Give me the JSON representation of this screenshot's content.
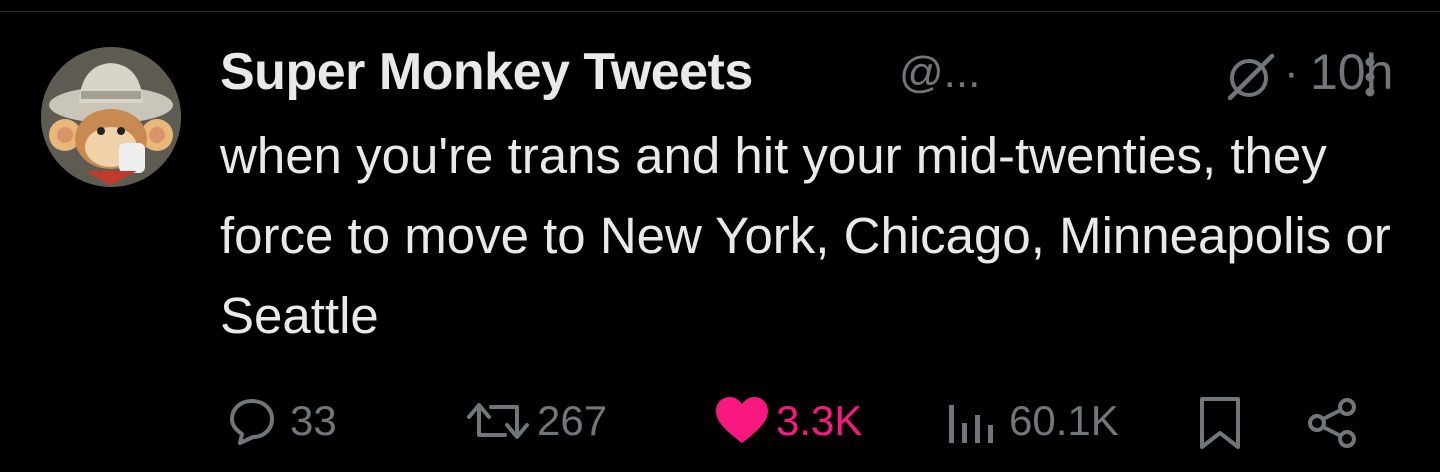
{
  "tweet": {
    "author": {
      "display_name": "Super Monkey Tweets",
      "handle": "@...",
      "avatar_icon": "monkey-cowboy-avatar"
    },
    "time_separator": "·",
    "timestamp": "10h",
    "header_icons": [
      "grok-icon",
      "more-options-icon"
    ],
    "text": "when you're trans and hit your mid-twenties, they force to move to New York, Chicago, Minneapolis or Seattle",
    "actions": {
      "replies": "33",
      "reposts": "267",
      "likes": "3.3K",
      "views": "60.1K"
    },
    "colors": {
      "background": "#000000",
      "text": "#e7e9ea",
      "secondary": "#71767b",
      "like": "#f91880"
    }
  }
}
